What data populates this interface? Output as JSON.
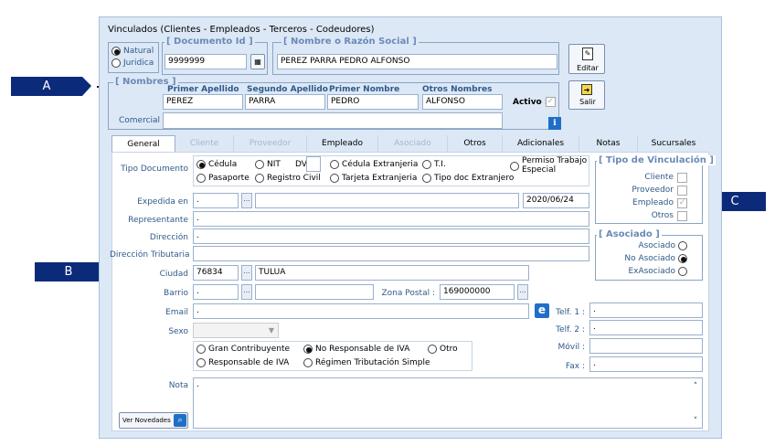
{
  "window_title": "Vinculados    (Clientes - Empleados - Terceros - Codeudores)",
  "person_type": {
    "natural": "Natural",
    "juridica": "Juridica"
  },
  "documento": {
    "legend": "[ Documento Id ]",
    "value": "9999999"
  },
  "nombre_razon": {
    "legend": "[ Nombre o Razón Social ]",
    "value": "PEREZ PARRA PEDRO ALFONSO"
  },
  "nombres": {
    "legend": "[ Nombres ]",
    "primer_apellido_label": "Primer Apellido",
    "primer_apellido": "PEREZ",
    "segundo_apellido_label": "Segundo Apellido",
    "segundo_apellido": "PARRA",
    "primer_nombre_label": "Primer Nombre",
    "primer_nombre": "PEDRO",
    "otros_nombres_label": "Otros Nombres",
    "otros_nombres": "ALFONSO",
    "activo_label": "Activo :",
    "comercial_label": "Comercial :",
    "comercial": ""
  },
  "buttons": {
    "editar": "Editar",
    "salir": "Salir",
    "info": "i",
    "ver_novedades": "Ver Novedades"
  },
  "tabs": [
    "General",
    "Cliente",
    "Proveedor",
    "Empleado",
    "Asociado",
    "Otros",
    "Adicionales",
    "Notas",
    "Sucursales"
  ],
  "general": {
    "tipo_documento_label": "Tipo Documento",
    "doc_types": {
      "cedula": "Cédula",
      "nit": "NIT",
      "dv": "DV",
      "cedula_ext": "Cédula Extranjeria",
      "ti": "T.I.",
      "permiso": "Permiso Trabajo",
      "especial": "Especial",
      "pasaporte": "Pasaporte",
      "registro": "Registro Civil",
      "tarjeta_ext": "Tarjeta Extranjeria",
      "tipo_doc_ext": "Tipo doc Extranjero"
    },
    "expedida_label": "Expedida en",
    "expedida_code": ".",
    "expedida_date": "2020/06/24",
    "representante_label": "Representante",
    "representante": ".",
    "direccion_label": "Dirección",
    "direccion": ".",
    "direccion_trib_label": "Dirección Tributaria",
    "direccion_trib": "",
    "ciudad_label": "Ciudad",
    "ciudad_code": "76834",
    "ciudad_name": "TULUA",
    "barrio_label": "Barrio",
    "barrio_code": ".",
    "zona_postal_label": "Zona Postal :",
    "zona_postal": "169000000",
    "email_label": "Email",
    "email": ".",
    "sexo_label": "Sexo",
    "telf1_label": "Telf. 1 :",
    "telf1": ".",
    "telf2_label": "Telf. 2 :",
    "telf2": ".",
    "movil_label": "Móvil :",
    "movil": "",
    "fax_label": "Fax :",
    "fax": ".",
    "regimen": {
      "gran": "Gran Contribuyente",
      "no_resp": "No Responsable de IVA",
      "otro": "Otro",
      "resp": "Responsable de IVA",
      "simple": "Régimen Tributación Simple"
    },
    "nota_label": "Nota",
    "nota": "."
  },
  "vinculacion": {
    "legend": "[ Tipo de Vinculación ]",
    "cliente": "Cliente",
    "proveedor": "Proveedor",
    "empleado": "Empleado",
    "otros": "Otros"
  },
  "asociado": {
    "legend": "[ Asociado ]",
    "asociado": "Asociado",
    "no_asociado": "No Asociado",
    "exasociado": "ExAsociado"
  },
  "callouts": {
    "a": "A",
    "b": "B",
    "c": "C"
  },
  "colors": {
    "callout": "#0b2a7a",
    "window": "#dce8f6",
    "legend": "#6a8ab8"
  }
}
